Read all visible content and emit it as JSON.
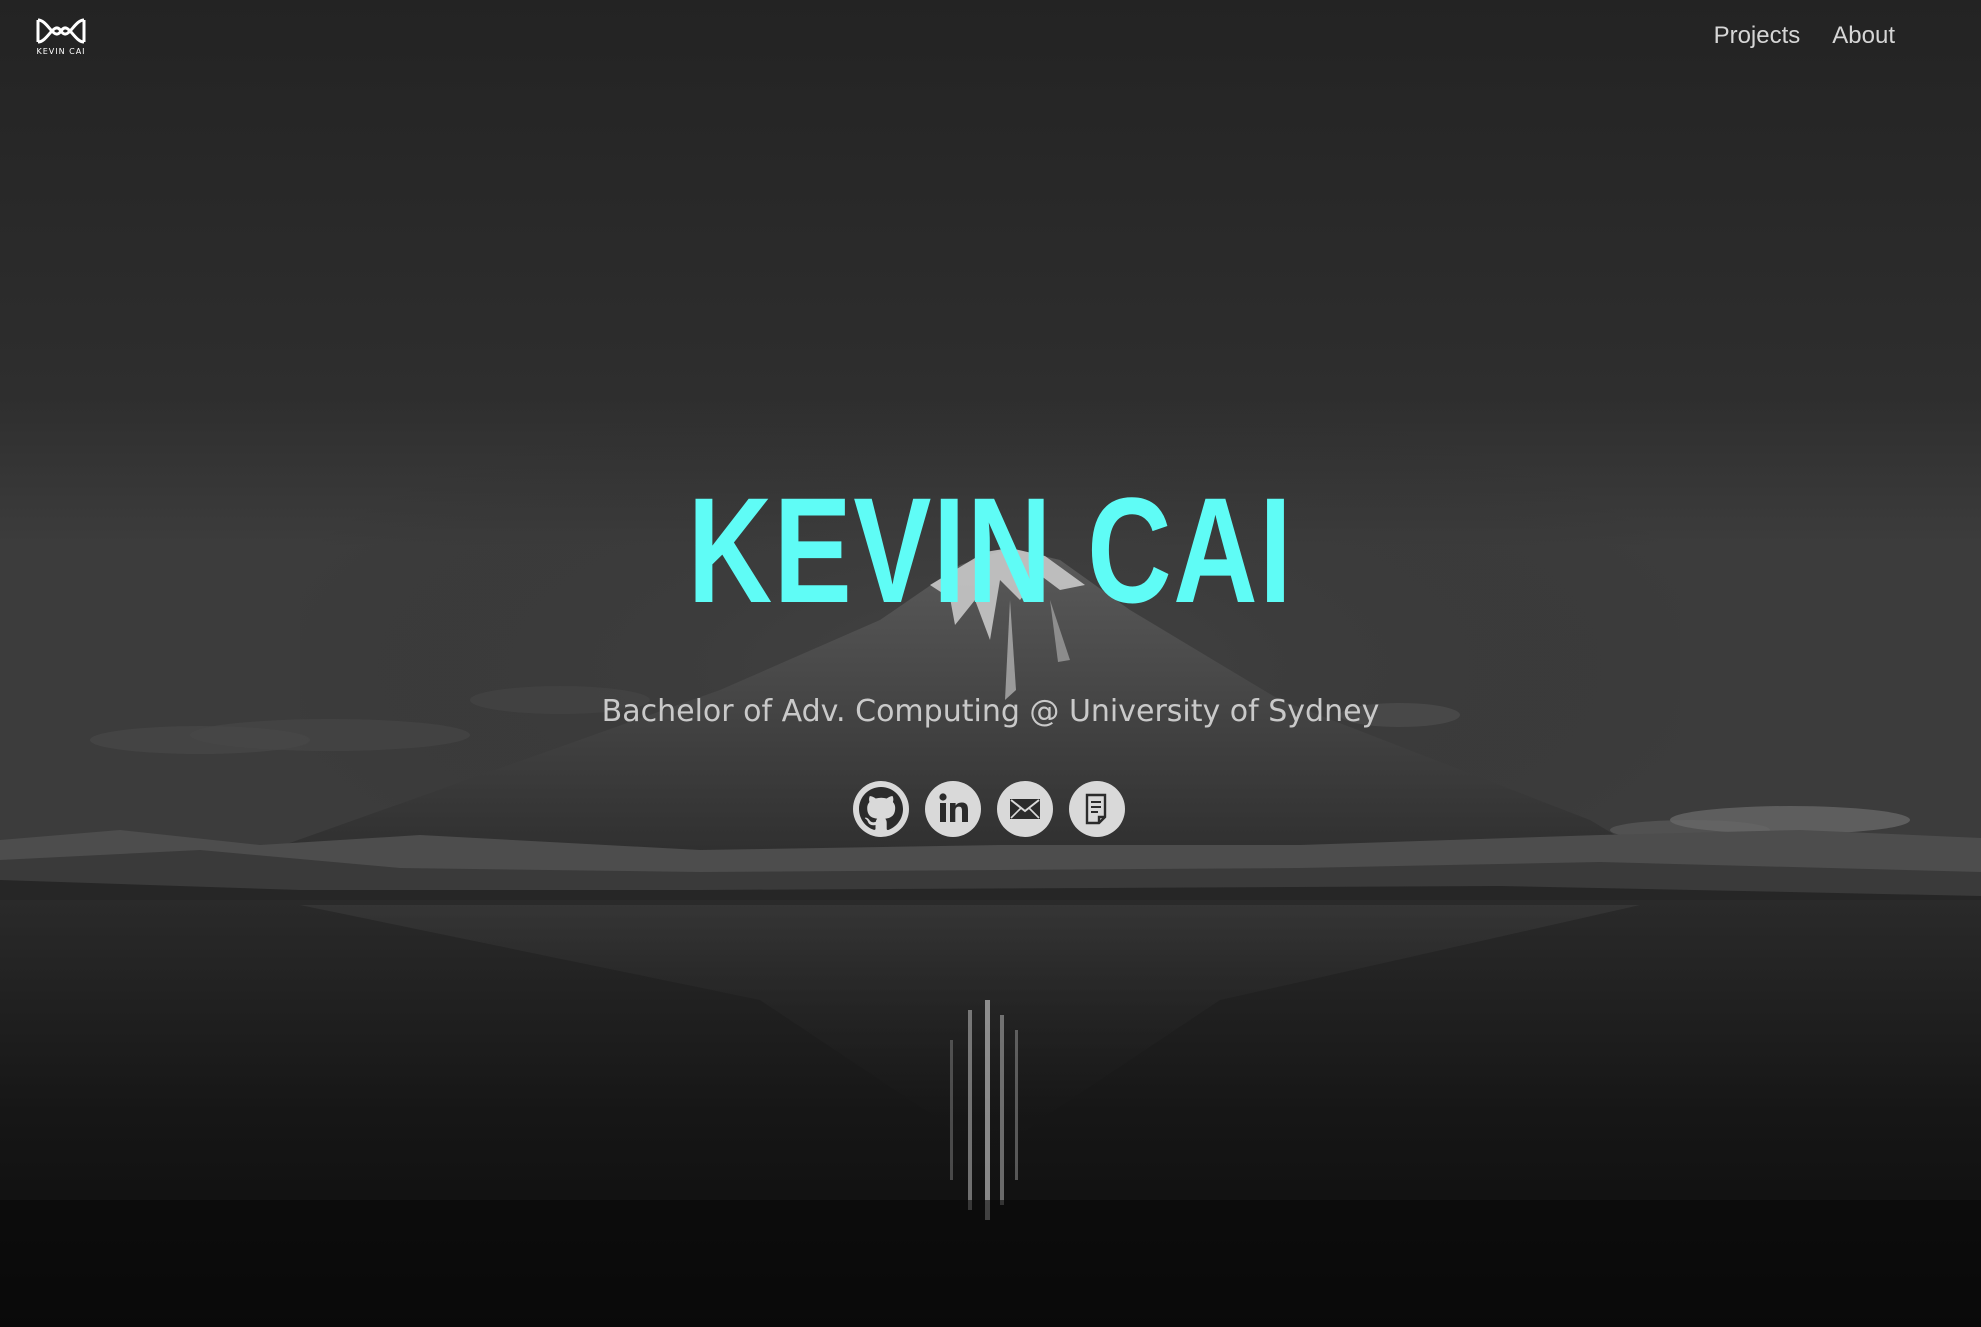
{
  "logo": {
    "text": "KEVIN CAI",
    "icon": "interlocking-loops-icon"
  },
  "nav": {
    "items": [
      {
        "label": "Projects"
      },
      {
        "label": "About"
      }
    ]
  },
  "hero": {
    "title": "KEVIN CAI",
    "subtitle": "Bachelor of Adv. Computing @ University of Sydney",
    "background": "mountain-lake-monochrome-photo"
  },
  "socials": [
    {
      "icon": "github-icon"
    },
    {
      "icon": "linkedin-icon"
    },
    {
      "icon": "email-icon"
    },
    {
      "icon": "document-icon"
    }
  ],
  "colors": {
    "accent": "#5ffcf6",
    "subtitle": "#c9c9c9",
    "nav": "#d6d6d6",
    "icon_bg": "#d9d9d9",
    "icon_fg": "#2b2b2b"
  }
}
